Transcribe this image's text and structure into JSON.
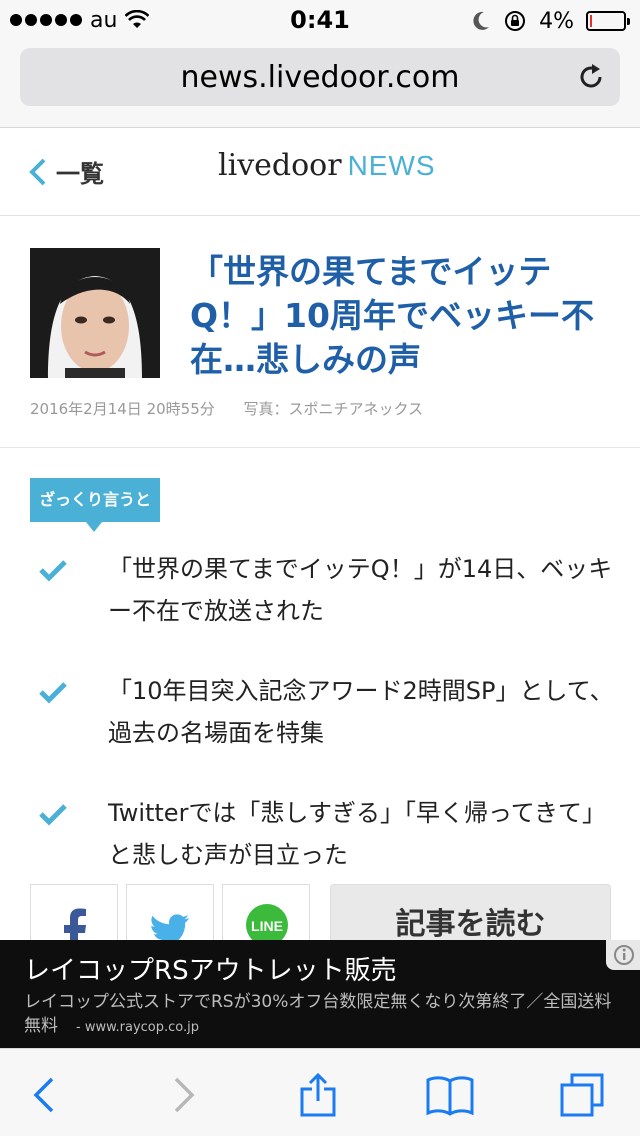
{
  "status_bar": {
    "carrier": "au",
    "time": "0:41",
    "battery_percent": "4%",
    "battery_level": 0.04,
    "icons": [
      "signal-dots-icon",
      "wifi-icon",
      "moon-icon",
      "rotation-lock-icon",
      "battery-icon"
    ]
  },
  "browser": {
    "url": "news.livedoor.com",
    "reload_icon": "reload-icon"
  },
  "site_header": {
    "back_label": "一覧",
    "logo_main": "livedoor",
    "logo_sub": "NEWS",
    "logo_color": "#4ab0d5"
  },
  "article": {
    "headline": "「世界の果てまでイッテQ！」10周年でベッキー不在…悲しみの声",
    "date": "2016年2月14日 20時55分",
    "photo_credit": "写真：スポニチアネックス",
    "headline_color": "#1f5fa8"
  },
  "summary": {
    "tag": "ざっくり言うと",
    "points": [
      "「世界の果てまでイッテQ！」が14日、ベッキー不在で放送された",
      "「10年目突入記念アワード2時間SP」として、過去の名場面を特集",
      "Twitterでは「悲しすぎる」「早く帰ってきて」と悲しむ声が目立った"
    ]
  },
  "share": {
    "facebook_icon": "facebook-icon",
    "twitter_icon": "twitter-icon",
    "line_label": "LINE",
    "read_button": "記事を読む"
  },
  "ad": {
    "title": "レイコップRSアウトレット販売",
    "description": "レイコップ公式ストアでRSが30%オフ台数限定無くなり次第終了／全国送料無料",
    "domain": "- www.raycop.co.jp"
  },
  "toolbar": {
    "icons": [
      "back-icon",
      "forward-icon",
      "share-icon",
      "bookmarks-icon",
      "tabs-icon"
    ],
    "accent": "#1a7bf2"
  }
}
